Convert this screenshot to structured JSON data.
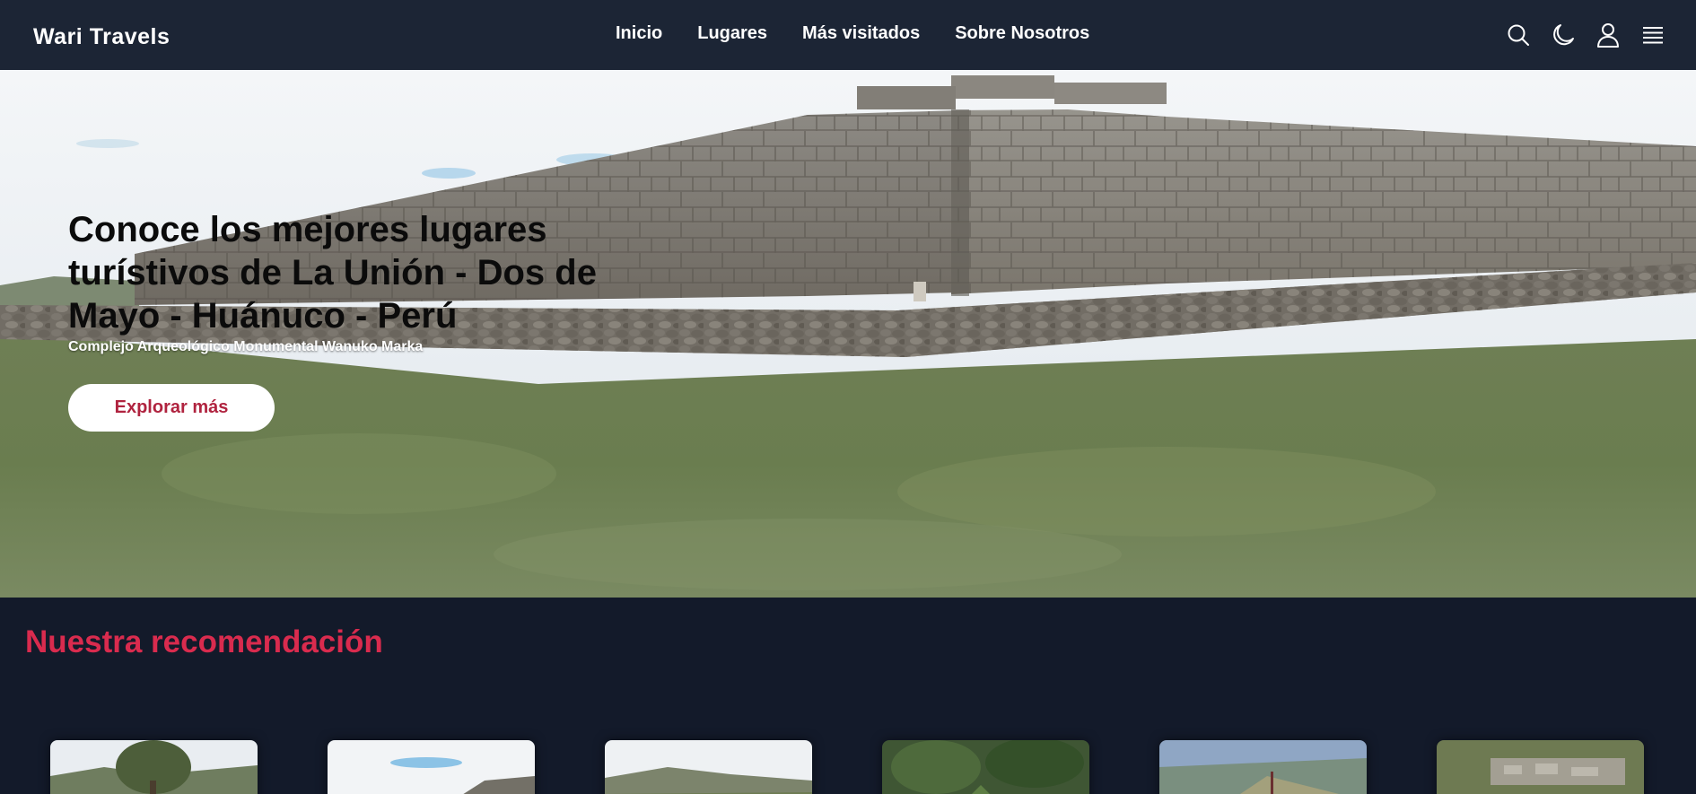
{
  "navbar": {
    "logo": "Wari Travels",
    "links": [
      "Inicio",
      "Lugares",
      "Más visitados",
      "Sobre Nosotros"
    ],
    "icons": [
      "search-icon",
      "moon-icon",
      "user-icon",
      "menu-icon"
    ]
  },
  "hero": {
    "title": "Conoce los mejores lugares turístivos de La Unión - Dos de Mayo - Huánuco - Perú",
    "subtitle": "Complejo Arqueológico Monumental Wanuko Marka",
    "button_label": "Explorar más"
  },
  "recommendation": {
    "title": "Nuestra recomendación",
    "card_count": 6
  },
  "colors": {
    "navbar_bg": "#1c2535",
    "page_bg": "#131a2a",
    "accent": "#d92b4e",
    "button_text": "#b0233f"
  }
}
